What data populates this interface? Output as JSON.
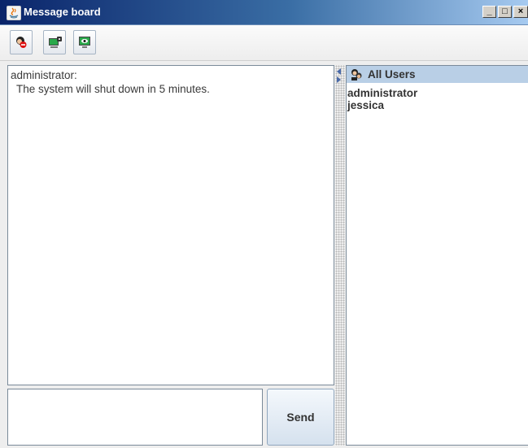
{
  "window": {
    "title": "Message board",
    "controls": {
      "minimize": "_",
      "maximize": "□",
      "close": "×"
    }
  },
  "toolbar": {
    "buttons": [
      {
        "icon": "stop-user-icon"
      },
      {
        "icon": "monitor-lock-icon"
      },
      {
        "icon": "monitor-eye-icon"
      }
    ]
  },
  "messages": [
    {
      "sender": "administrator:",
      "text": "The system will shut down in 5 minutes."
    }
  ],
  "compose": {
    "value": "",
    "send_label": "Send"
  },
  "users": {
    "header": "All Users",
    "items": [
      "administrator",
      "jessica"
    ]
  },
  "colors": {
    "titlebar_dark": "#0a246a",
    "titlebar_light": "#a6caf0",
    "users_header_bg": "#b9cfe6"
  }
}
